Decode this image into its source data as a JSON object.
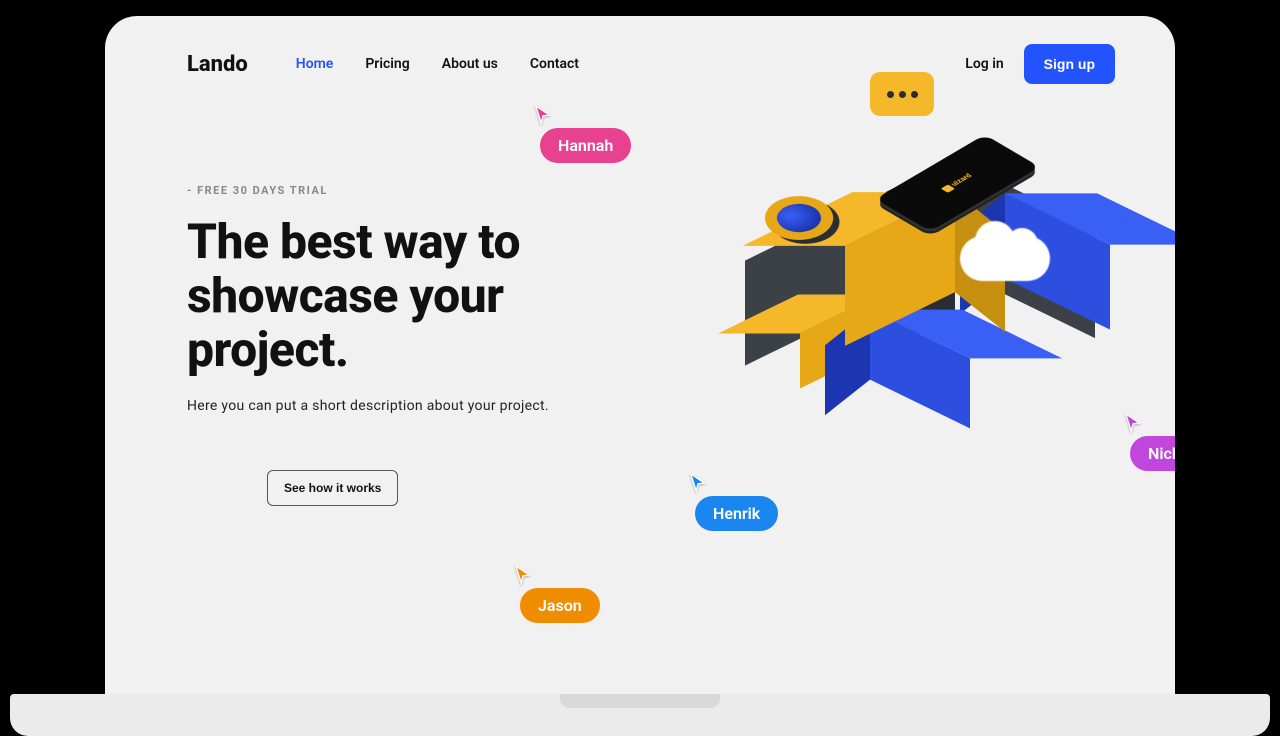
{
  "brand": "Lando",
  "nav": {
    "items": [
      {
        "label": "Home",
        "active": true
      },
      {
        "label": "Pricing",
        "active": false
      },
      {
        "label": "About us",
        "active": false
      },
      {
        "label": "Contact",
        "active": false
      }
    ],
    "login": "Log in",
    "signup": "Sign up"
  },
  "hero": {
    "eyebrow": "- FREE 30 DAYS TRIAL",
    "headline": "The best way to showcase your project.",
    "subhead": "Here you can put a short description about your project.",
    "secondary_cta": "See how it works",
    "phone_brand": "uizard"
  },
  "cursors": {
    "hannah": {
      "name": "Hannah",
      "color": "#e8418f"
    },
    "henrik": {
      "name": "Henrik",
      "color": "#1a87f0"
    },
    "jason": {
      "name": "Jason",
      "color": "#f08c00"
    },
    "nick": {
      "name": "Nick",
      "color": "#c146dc"
    }
  }
}
